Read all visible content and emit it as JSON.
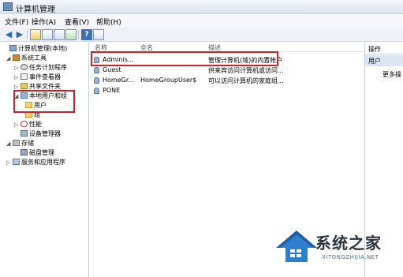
{
  "window": {
    "title": "计算机管理"
  },
  "menu": [
    "文件(F)",
    "操作(A)",
    "查看(V)",
    "帮助(H)"
  ],
  "tree": {
    "items": [
      {
        "label": "计算机管理(本地)",
        "expander": "",
        "icon": "computer-icon",
        "indent": 0
      },
      {
        "label": "系统工具",
        "expander": "◢",
        "icon": "tools-icon",
        "indent": 1
      },
      {
        "label": "任务计划程序",
        "expander": "▷",
        "icon": "clock-icon",
        "indent": 2
      },
      {
        "label": "事件查看器",
        "expander": "▷",
        "icon": "event-viewer-icon",
        "indent": 2
      },
      {
        "label": "共享文件夹",
        "expander": "▷",
        "icon": "shared-folder-icon",
        "indent": 2
      },
      {
        "label": "本地用户和组",
        "expander": "◢",
        "icon": "users-icon",
        "indent": 2
      },
      {
        "label": "用户",
        "expander": "",
        "icon": "folder-icon",
        "indent": 3
      },
      {
        "label": "组",
        "expander": "",
        "icon": "folder-icon",
        "indent": 3
      },
      {
        "label": "性能",
        "expander": "▷",
        "icon": "performance-icon",
        "indent": 2
      },
      {
        "label": "设备管理器",
        "expander": "",
        "icon": "device-manager-icon",
        "indent": 2
      },
      {
        "label": "存储",
        "expander": "◢",
        "icon": "storage-icon",
        "indent": 1
      },
      {
        "label": "磁盘管理",
        "expander": "",
        "icon": "disk-icon",
        "indent": 2
      },
      {
        "label": "服务和应用程序",
        "expander": "▷",
        "icon": "services-icon",
        "indent": 1
      }
    ]
  },
  "list": {
    "columns": [
      "名称",
      "全名",
      "描述"
    ],
    "rows": [
      {
        "name": "Adminis...",
        "full_name": "",
        "description": "管理计算机(域)的内置帐户"
      },
      {
        "name": "Guest",
        "full_name": "",
        "description": "供来宾访问计算机或访问..."
      },
      {
        "name": "HomeGr...",
        "full_name": "HomeGroupUser$",
        "description": "可以访问计算机的家庭组..."
      },
      {
        "name": "PONE",
        "full_name": "",
        "description": ""
      }
    ]
  },
  "actions": {
    "header": "操作",
    "section": "用户",
    "item": "更多操"
  },
  "watermark": {
    "name": "系统之家",
    "url": "XITONGZHIJIA.NET"
  },
  "colors": {
    "highlight": "#c0262d",
    "accent": "#2d6bb3"
  }
}
